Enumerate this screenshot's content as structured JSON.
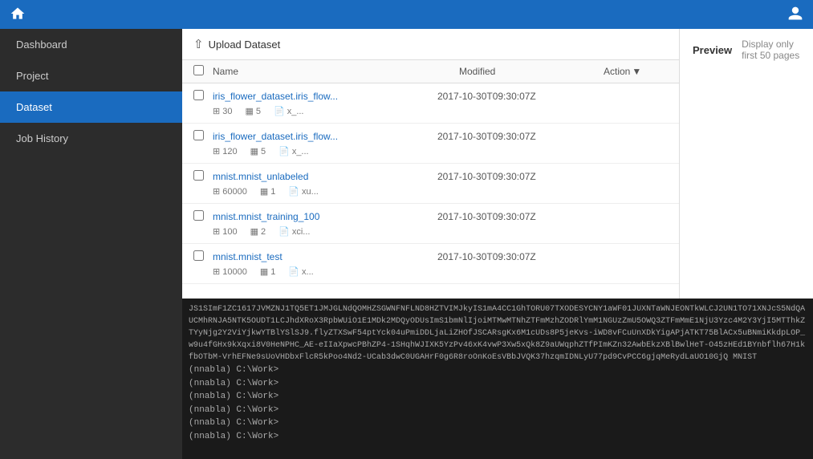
{
  "topNav": {
    "homeIcon": "home",
    "userIcon": "user"
  },
  "sidebar": {
    "items": [
      {
        "label": "Dashboard",
        "active": false
      },
      {
        "label": "Project",
        "active": false
      },
      {
        "label": "Dataset",
        "active": true
      },
      {
        "label": "Job History",
        "active": false
      }
    ]
  },
  "toolbar": {
    "uploadLabel": "Upload Dataset"
  },
  "tableHeader": {
    "nameLabel": "Name",
    "modifiedLabel": "Modified",
    "actionLabel": "Action"
  },
  "datasets": [
    {
      "name": "iris_flower_dataset.iris_flow...",
      "modified": "2017-10-30T09:30:07Z",
      "meta": [
        {
          "icon": "table",
          "value": "30"
        },
        {
          "icon": "columns",
          "value": "5"
        },
        {
          "icon": "file",
          "value": "x_..."
        }
      ]
    },
    {
      "name": "iris_flower_dataset.iris_flow...",
      "modified": "2017-10-30T09:30:07Z",
      "meta": [
        {
          "icon": "table",
          "value": "120"
        },
        {
          "icon": "columns",
          "value": "5"
        },
        {
          "icon": "file",
          "value": "x_..."
        }
      ]
    },
    {
      "name": "mnist.mnist_unlabeled",
      "modified": "2017-10-30T09:30:07Z",
      "meta": [
        {
          "icon": "table",
          "value": "60000"
        },
        {
          "icon": "columns",
          "value": "1"
        },
        {
          "icon": "file",
          "value": "xu..."
        }
      ]
    },
    {
      "name": "mnist.mnist_training_100",
      "modified": "2017-10-30T09:30:07Z",
      "meta": [
        {
          "icon": "table",
          "value": "100"
        },
        {
          "icon": "columns",
          "value": "2"
        },
        {
          "icon": "file",
          "value": "xci..."
        }
      ]
    },
    {
      "name": "mnist.mnist_test",
      "modified": "2017-10-30T09:30:07Z",
      "meta": [
        {
          "icon": "table",
          "value": "10000"
        },
        {
          "icon": "columns",
          "value": "1"
        },
        {
          "icon": "file",
          "value": "x..."
        }
      ]
    }
  ],
  "preview": {
    "title": "Preview",
    "note": "Display only first 50 pages"
  },
  "terminal": {
    "lines": [
      {
        "type": "data",
        "text": "JS1SImF1ZC1617JVMZNJ1TQ5ET1JMJGLNdQOMHZSGWNFNFLND8HZTVIMJkyIS1mA4CC1GhTORU07TXODESYCNY1aWF01JUXNTaWNJEONTkWLCJ2UN1TO71XNJcS5NdQAUCMhRNJA5NTK5OUDT1LCJhdXRoX3RpbWUiO1E1MDk2MDQyODUsImS1bmNlIjoiMTMwMTNhZTFmMzhZODRlYmM1NGUzZmU5OWQ3ZTFmMmE1NjU3Yzc4M2Y3YjI5MTThkZTYyNjg2Y2ViYjkwYTBlYSlSJ9.flyZTXSwF54ptYck04uPmiDDLjaLiZHOfJSCARsgKx6M1cUDs8P5jeKvs-iWD8vFCuUnXDkYigAPjATKT75BlACx5uBNmiKkdpLOP_w9u4fGHx9kXqxi8V0HeNPHC_AE-eIIaXpwcPBhZP4-1SHqhWJIXK5YzPv46xK4vwP3Xw5xQk8Z9aUWqphZTfPImKZn32AwbEkzXBlBwlHeT-O45zHEd1BYnbflh67H1kfbOTbM-VrhEFNe9sUoVHDbxFlcR5kPoo4Nd2-UCab3dwC0UGAHrF0g6R8roOnKoEsVBbJVQK37hzqmIDNLyU77pd9CvPCC6gjqMeRydLaUO10GjQ MNIST"
      },
      {
        "type": "prompt",
        "text": "(nnabla) C:\\Work>",
        "cmd": ""
      },
      {
        "type": "prompt",
        "text": "(nnabla) C:\\Work>",
        "cmd": ""
      },
      {
        "type": "prompt",
        "text": "(nnabla) C:\\Work>",
        "cmd": ""
      },
      {
        "type": "prompt",
        "text": "(nnabla) C:\\Work>",
        "cmd": ""
      },
      {
        "type": "prompt",
        "text": "(nnabla) C:\\Work>",
        "cmd": ""
      },
      {
        "type": "prompt",
        "text": "(nnabla) C:\\Work>",
        "cmd": ""
      }
    ]
  }
}
